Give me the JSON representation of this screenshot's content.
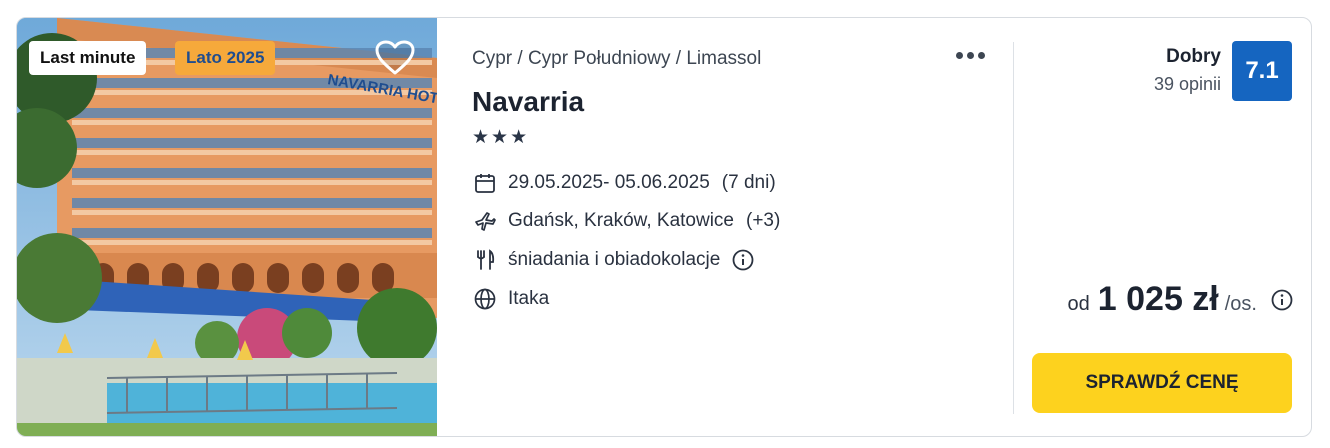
{
  "badges": {
    "last_minute": "Last minute",
    "season": "Lato 2025"
  },
  "photo": {
    "sign_text": "NAVARRIA HOT"
  },
  "breadcrumb": "Cypr / Cypr Południowy / Limassol",
  "hotel": {
    "name": "Navarria",
    "stars": "★★★",
    "dates": "29.05.2025- 05.06.2025",
    "duration": "(7 dni)",
    "departures": "Gdańsk, Kraków, Katowice",
    "departures_more": "(+3)",
    "board": "śniadania i obiadokolacje",
    "operator": "Itaka"
  },
  "rating": {
    "label": "Dobry",
    "count": "39 opinii",
    "score": "7.1"
  },
  "price": {
    "prefix": "od",
    "value": "1 025 zł",
    "suffix": "/os."
  },
  "cta_label": "SPRAWDŹ CENĘ",
  "colors": {
    "score_bg": "#1565c0",
    "cta_bg": "#fdd21e",
    "season_badge_bg": "#f6a93b"
  },
  "icons": [
    "heart-icon",
    "more-icon",
    "calendar-icon",
    "plane-icon",
    "cutlery-icon",
    "info-icon",
    "globe-icon"
  ]
}
